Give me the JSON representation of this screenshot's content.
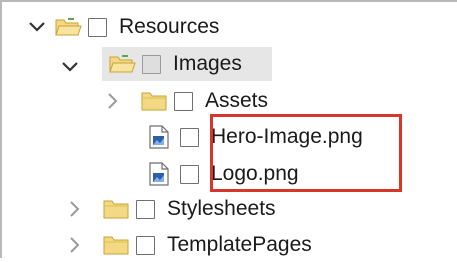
{
  "tree": {
    "items": [
      {
        "label": "Resources",
        "kind": "folder",
        "chevron": "chevron-down-icon",
        "selected": false
      },
      {
        "label": "Images",
        "kind": "folder",
        "chevron": "chevron-down-icon",
        "selected": true
      },
      {
        "label": "Assets",
        "kind": "folder",
        "chevron": "chevron-right-icon",
        "selected": false
      },
      {
        "label": "Hero-Image.png",
        "kind": "file",
        "icon": "image-file-icon",
        "selected": false
      },
      {
        "label": "Logo.png",
        "kind": "file",
        "icon": "image-file-icon",
        "selected": false
      },
      {
        "label": "Stylesheets",
        "kind": "folder",
        "chevron": "chevron-right-icon",
        "selected": false
      },
      {
        "label": "TemplatePages",
        "kind": "folder",
        "chevron": "chevron-right-icon",
        "selected": false
      }
    ]
  },
  "colors": {
    "folder_fill": "#f3d983",
    "folder_stroke": "#c9a232",
    "selected_row": "#e6e6e6",
    "highlight_border": "#d9362b",
    "file_icon_blue": "#2d5fa8"
  }
}
